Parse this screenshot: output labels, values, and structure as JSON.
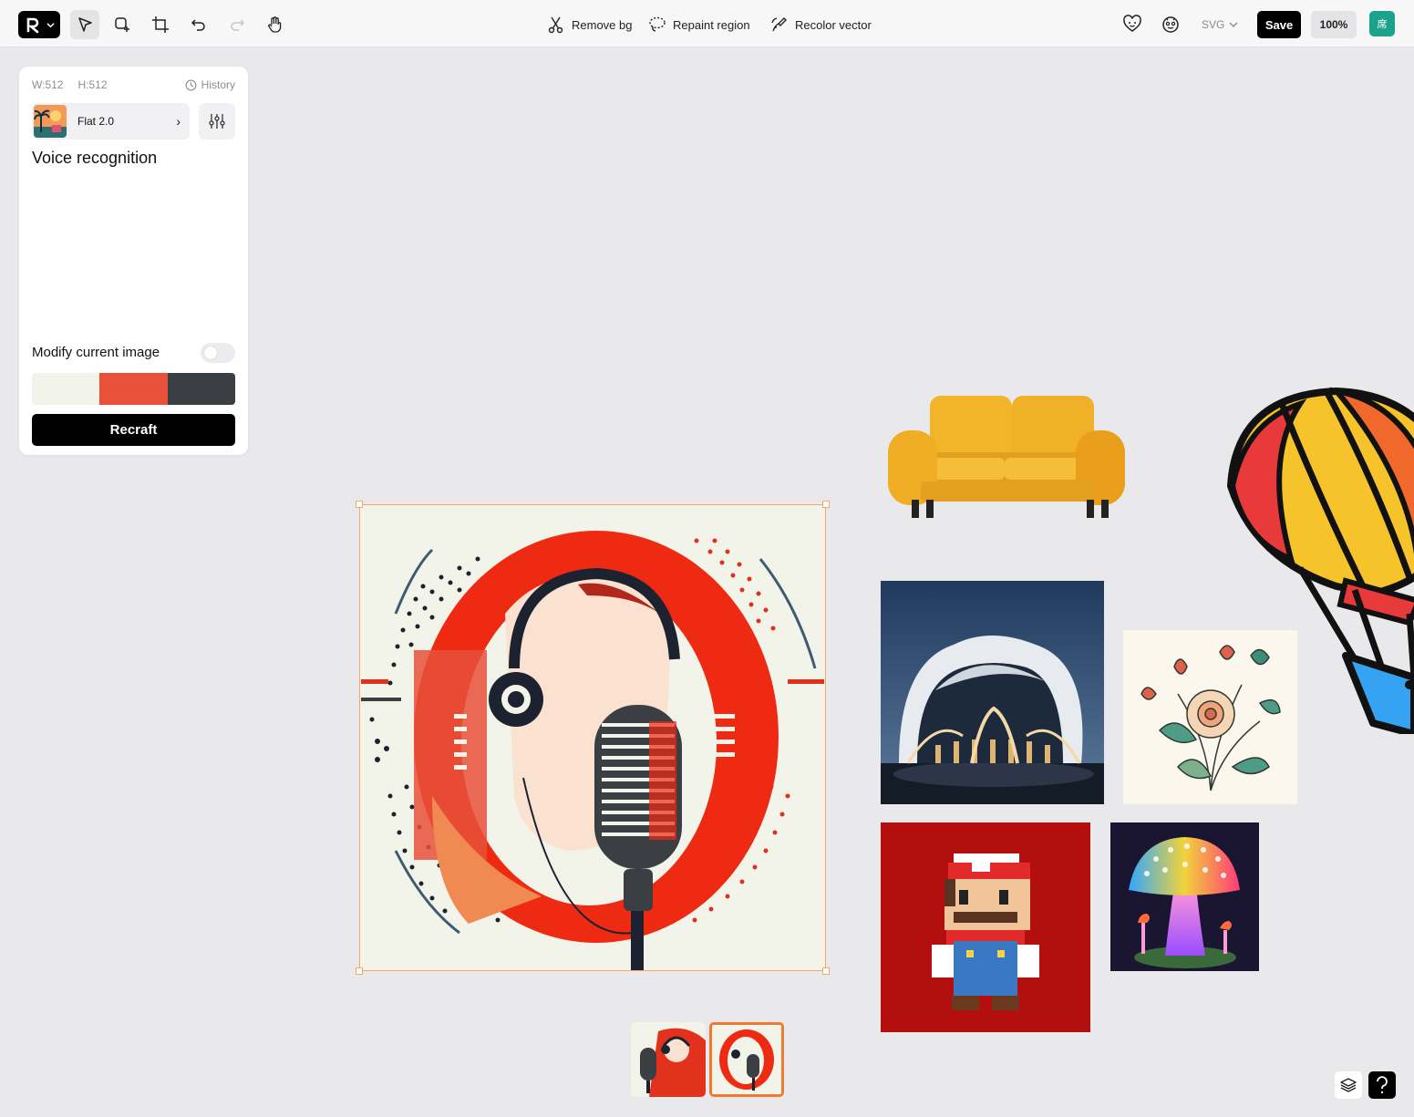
{
  "toolbar": {
    "remove_bg": "Remove bg",
    "repaint_region": "Repaint region",
    "recolor_vector": "Recolor vector",
    "format": "SVG",
    "save": "Save",
    "zoom": "100%",
    "avatar_text": "席"
  },
  "panel": {
    "width_label": "W:512",
    "height_label": "H:512",
    "history": "History",
    "style_name": "Flat 2.0",
    "prompt": "Voice recognition",
    "modify_label": "Modify current image",
    "modify_enabled": false,
    "palette": [
      "#f3f4e9",
      "#e8503a",
      "#3b3f43"
    ],
    "recraft": "Recraft"
  },
  "canvas": {
    "items": [
      "voice-recognition-illustration",
      "yellow-sofa",
      "hot-air-balloon",
      "futuristic-building",
      "flower-bouquet",
      "pixel-plumber",
      "neon-mushroom"
    ],
    "variation_count": 2,
    "selected_variation": 2
  },
  "colors": {
    "accent": "#f07a2e",
    "selection": "#f3a86a",
    "avatar_bg": "#1aa38a"
  }
}
